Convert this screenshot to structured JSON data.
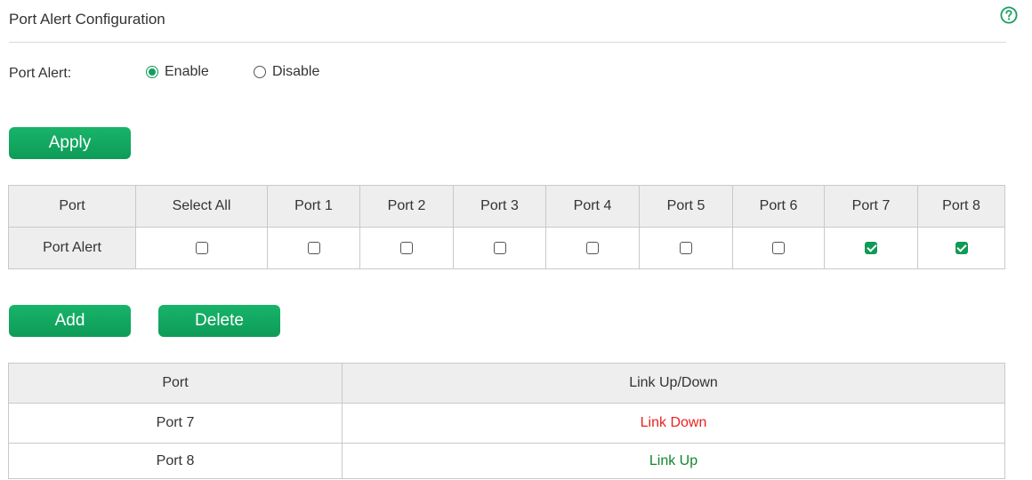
{
  "page": {
    "title": "Port Alert Configuration"
  },
  "port_alert": {
    "label": "Port Alert:",
    "options": [
      {
        "label": "Enable",
        "checked": true
      },
      {
        "label": "Disable",
        "checked": false
      }
    ]
  },
  "buttons": {
    "apply": "Apply",
    "add": "Add",
    "delete": "Delete"
  },
  "port_table": {
    "header_label": "Port",
    "select_all": "Select All",
    "ports": [
      "Port 1",
      "Port 2",
      "Port 3",
      "Port 4",
      "Port 5",
      "Port 6",
      "Port 7",
      "Port 8"
    ],
    "row_label": "Port Alert",
    "select_all_checked": false,
    "checked": [
      false,
      false,
      false,
      false,
      false,
      false,
      true,
      true
    ]
  },
  "link_table": {
    "headers": [
      "Port",
      "Link Up/Down"
    ],
    "rows": [
      {
        "port": "Port 7",
        "status": "Link Down",
        "state": "down"
      },
      {
        "port": "Port 8",
        "status": "Link Up",
        "state": "up"
      }
    ]
  },
  "colors": {
    "accent": "#12a05c",
    "link_down": "#e8231f",
    "link_up": "#14852e"
  }
}
